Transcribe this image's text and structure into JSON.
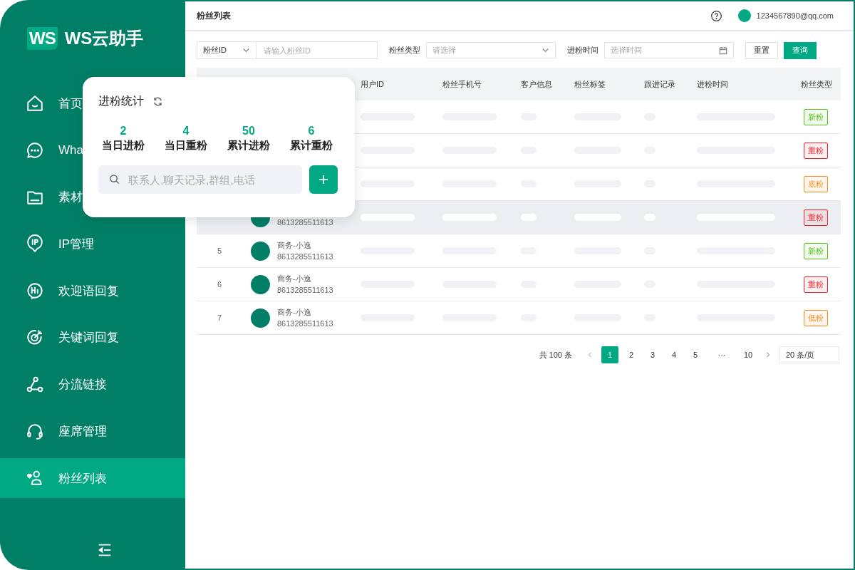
{
  "sidebar": {
    "logo": {
      "badge": "WS",
      "name": "WS云助手"
    },
    "items": [
      {
        "label": "首页",
        "selected": false
      },
      {
        "label": "Wha",
        "selected": false
      },
      {
        "label": "素材",
        "selected": false
      },
      {
        "label": "IP管理",
        "selected": false
      },
      {
        "label": "欢迎语回复",
        "selected": false
      },
      {
        "label": "关键词回复",
        "selected": false
      },
      {
        "label": "分流链接",
        "selected": false
      },
      {
        "label": "座席管理",
        "selected": false
      },
      {
        "label": "粉丝列表",
        "selected": true
      }
    ]
  },
  "header": {
    "title": "粉丝列表",
    "user_email": "1234567890@qq.com"
  },
  "filters": {
    "id_select": "粉丝ID",
    "id_placeholder": "请输入粉丝ID",
    "type_label": "粉丝类型",
    "type_placeholder": "请选择",
    "time_label": "进粉时间",
    "time_placeholder": "选择时间",
    "buttons": [
      {
        "label": "重置",
        "kind": "plain"
      },
      {
        "label": "查询",
        "kind": "primary"
      }
    ]
  },
  "table": {
    "columns": [
      "用户ID",
      "粉丝手机号",
      "客户信息",
      "粉丝标签",
      "跟进记录",
      "进粉时间",
      "粉丝类型"
    ],
    "rows": [
      {
        "selected": false,
        "type": {
          "label": "新粉",
          "color": "#52c41a"
        }
      },
      {
        "selected": false,
        "type": {
          "label": "重粉",
          "color": "#f5222d"
        }
      },
      {
        "selected": false,
        "type": {
          "label": "底粉",
          "color": "#fa8c16"
        }
      },
      {
        "selected": true,
        "phone": "8613285511613",
        "type": {
          "label": "重粉",
          "color": "#f5222d"
        }
      },
      {
        "selected": false,
        "index": "5",
        "name": "商务-小逸",
        "phone": "8613285511613",
        "type": {
          "label": "新粉",
          "color": "#52c41a"
        }
      },
      {
        "selected": false,
        "index": "6",
        "name": "商务-小逸",
        "phone": "8613285511613",
        "type": {
          "label": "重粉",
          "color": "#f5222d"
        }
      },
      {
        "selected": false,
        "index": "7",
        "name": "商务-小逸",
        "phone": "8613285511613",
        "type": {
          "label": "低粉",
          "color": "#fa8c16"
        }
      }
    ]
  },
  "pagination": {
    "total": "共 100 条",
    "pages": [
      {
        "label": "1",
        "selected": true
      },
      {
        "label": "2",
        "selected": false
      },
      {
        "label": "3",
        "selected": false
      },
      {
        "label": "4",
        "selected": false
      },
      {
        "label": "5",
        "selected": false
      },
      {
        "label": "···",
        "selected": false
      },
      {
        "label": "10",
        "selected": false
      }
    ],
    "page_size": "20 条/页"
  },
  "stats_popup": {
    "title": "进粉统计",
    "stats": [
      {
        "value": "2",
        "label": "当日进粉"
      },
      {
        "value": "4",
        "label": "当日重粉"
      },
      {
        "value": "50",
        "label": "累计进粉"
      },
      {
        "value": "6",
        "label": "累计重粉"
      }
    ],
    "search_placeholder": "联系人,聊天记录,群组,电话"
  }
}
